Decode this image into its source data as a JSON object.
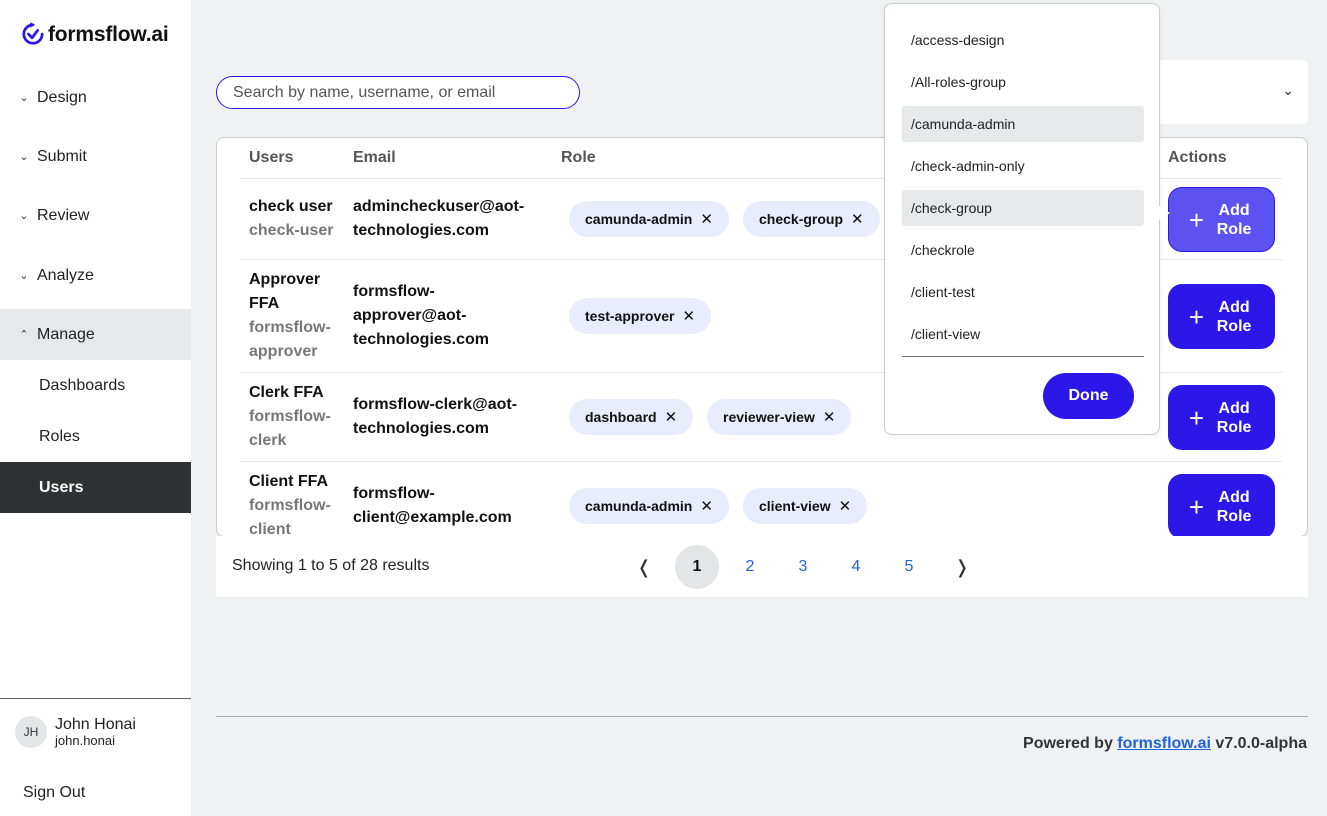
{
  "app": {
    "logo_text": "formsflow.ai",
    "accent_color": "#2c17e8"
  },
  "sidebar": {
    "sections": [
      {
        "label": "Design",
        "chevron": "chevron-down-icon"
      },
      {
        "label": "Submit",
        "chevron": "chevron-down-icon"
      },
      {
        "label": "Review",
        "chevron": "chevron-down-icon"
      },
      {
        "label": "Analyze",
        "chevron": "chevron-down-icon"
      },
      {
        "label": "Manage",
        "chevron": "chevron-up-icon"
      }
    ],
    "manage_items": [
      {
        "label": "Dashboards"
      },
      {
        "label": "Roles"
      },
      {
        "label": "Users",
        "selected": true
      }
    ],
    "user": {
      "initials": "JH",
      "name": "John Honai",
      "handle": "john.honai"
    },
    "sign_out": "Sign Out"
  },
  "search": {
    "placeholder": "Search by name, username, or email",
    "value": ""
  },
  "table": {
    "headers": {
      "users": "Users",
      "email": "Email",
      "role": "Role",
      "actions": "Actions"
    },
    "rows": [
      {
        "name": "check user",
        "login": "check-user",
        "email_1": "admincheckuser@aot-",
        "email_2": "technologies.com",
        "roles": [
          "camunda-admin",
          "check-group"
        ],
        "action": "Add Role"
      },
      {
        "name_1": "Approver",
        "name_2": "FFA",
        "login_1": "formsflow-",
        "login_2": "approver",
        "email_1": "formsflow-",
        "email_2": "approver@aot-",
        "email_3": "technologies.com",
        "roles": [
          "test-approver"
        ],
        "action": "Add Role"
      },
      {
        "name": "Clerk FFA",
        "login_1": "formsflow-",
        "login_2": "clerk",
        "email_1": "formsflow-clerk@aot-",
        "email_2": "technologies.com",
        "roles": [
          "dashboard",
          "reviewer-view"
        ],
        "action": "Add Role"
      },
      {
        "name": "Client FFA",
        "login_1": "formsflow-",
        "login_2": "client",
        "email_1": "formsflow-",
        "email_2": "client@example.com",
        "roles": [
          "camunda-admin",
          "client-view"
        ],
        "action": "Add Role"
      }
    ]
  },
  "pagination": {
    "summary": "Showing 1 to 5 of 28 results",
    "prev": "❬",
    "next": "❭",
    "pages": [
      "1",
      "2",
      "3",
      "4",
      "5"
    ],
    "current": "1"
  },
  "footer": {
    "prefix": "Powered by",
    "link": "formsflow.ai",
    "version": "v7.0.0-alpha"
  },
  "role_dropdown": {
    "options": [
      {
        "label": "/access-design"
      },
      {
        "label": "/All-roles-group"
      },
      {
        "label": "/camunda-admin",
        "highlighted": true
      },
      {
        "label": "/check-admin-only"
      },
      {
        "label": "/check-group",
        "highlighted": true
      },
      {
        "label": "/checkrole"
      },
      {
        "label": "/client-test"
      },
      {
        "label": "/client-view"
      }
    ],
    "done_label": "Done"
  }
}
